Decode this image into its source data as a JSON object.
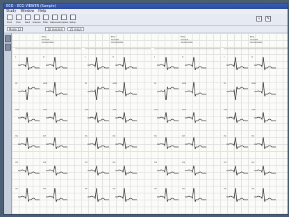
{
  "window": {
    "title": "ECG - ECG VIEWER (Sample)"
  },
  "menu": [
    "Study",
    "Window",
    "Help"
  ],
  "toolbar": [
    {
      "label": "Print",
      "icon": "print-icon"
    },
    {
      "label": "Prev",
      "icon": "prev-icon"
    },
    {
      "label": "Next",
      "icon": "next-icon"
    },
    {
      "label": "Analyze",
      "icon": "analyze-icon"
    },
    {
      "label": "Filter",
      "icon": "filter-icon"
    },
    {
      "label": "Measure",
      "icon": "measure-icon"
    },
    {
      "label": "Compare",
      "icon": "compare-icon"
    },
    {
      "label": "Setup",
      "icon": "setup-icon"
    }
  ],
  "options": {
    "lead_select": "Mode 12",
    "gain_value": "10 mm/mV",
    "speed_value": "25 mm/s"
  },
  "columns": [
    {
      "header": [
        "ECG",
        "Sample",
        "00/00/0000"
      ]
    },
    {
      "header": [
        "ECG",
        "Sample",
        "00/00/0000"
      ]
    },
    {
      "header": [
        "ECG",
        "Sample",
        "00/00/0000"
      ]
    },
    {
      "header": [
        "ECG",
        "Sample",
        "00/00/0000"
      ]
    }
  ],
  "leads": [
    "I",
    "II",
    "III",
    "aVR",
    "aVL",
    "aVF",
    "V1",
    "V2",
    "V3",
    "V4",
    "V5",
    "V6"
  ],
  "colors": {
    "trace": "#222222",
    "grid": "#e2e2e2",
    "title_bar": "#2c4a9a"
  }
}
